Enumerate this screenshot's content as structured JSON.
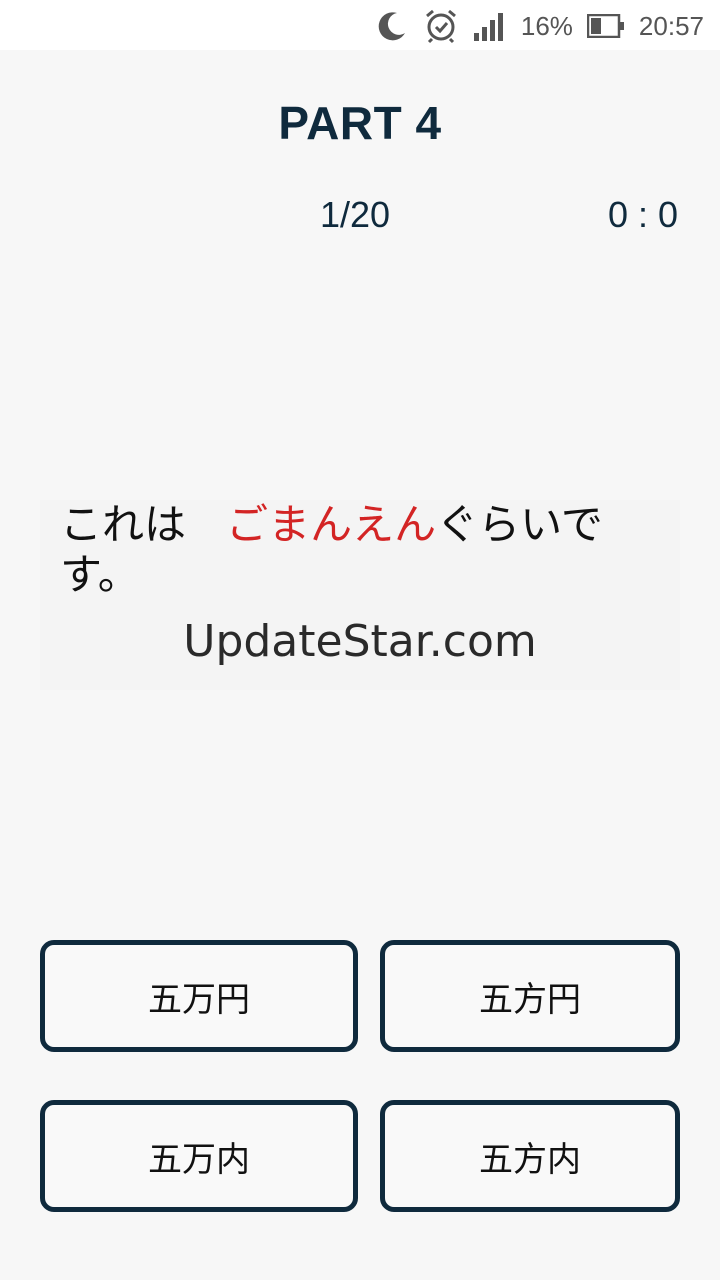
{
  "status_bar": {
    "battery_percent": "16%",
    "time": "20:57",
    "icons": [
      "moon-icon",
      "alarm-icon",
      "signal-icon",
      "battery-icon"
    ]
  },
  "header": {
    "title": "PART 4",
    "progress": "1/20",
    "score": "0 : 0"
  },
  "question": {
    "prefix": "これは",
    "highlight": "ごまんえん",
    "suffix": "ぐらいです。",
    "highlight_color": "#d32424"
  },
  "watermark": "UpdateStar.com",
  "answers": [
    {
      "label": "五万円"
    },
    {
      "label": "五方円"
    },
    {
      "label": "五万内"
    },
    {
      "label": "五方内"
    }
  ],
  "colors": {
    "primary": "#0f2a3d",
    "background": "#f7f7f7"
  }
}
